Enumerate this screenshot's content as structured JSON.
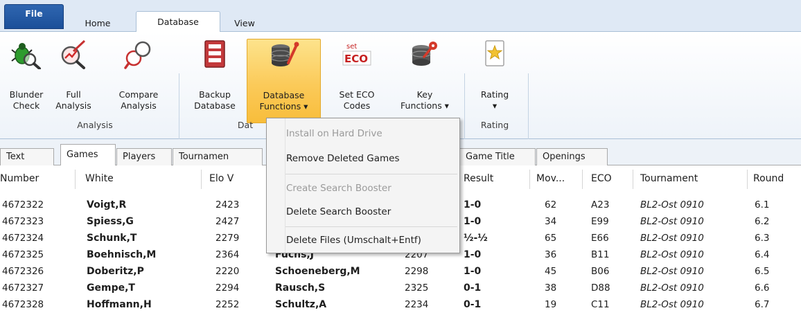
{
  "ribbon_tabs": {
    "file": "File",
    "home": "Home",
    "database": "Database",
    "view": "View"
  },
  "ribbon": {
    "analysis_group": {
      "label": "Analysis",
      "blunder_check": [
        "Blunder",
        "Check"
      ],
      "full_analysis": [
        "Full",
        "Analysis"
      ],
      "compare_analysis": [
        "Compare",
        "Analysis"
      ]
    },
    "database_group": {
      "label": "Dat",
      "backup_database": [
        "Backup",
        "Database"
      ],
      "database_functions": [
        "Database",
        "Functions ▾"
      ],
      "set_eco_codes": [
        "Set ECO",
        "Codes"
      ],
      "key_functions": [
        "Key",
        "Functions ▾"
      ]
    },
    "rating_group": {
      "label": "Rating",
      "rating": [
        "Rating",
        "▾"
      ]
    },
    "eco_icon_text": {
      "small": "set",
      "big": "ECO"
    },
    "active_color": "#fbca59"
  },
  "view_tabs": [
    "Text",
    "Games",
    "Players",
    "Tournamen",
    "Game Title",
    "Openings"
  ],
  "menu": {
    "install": "Install on Hard Drive",
    "remove_deleted": "Remove Deleted Games",
    "create_booster": "Create Search Booster",
    "delete_booster": "Delete Search Booster",
    "delete_files": "Delete Files (Umschalt+Entf)"
  },
  "table": {
    "headers": {
      "number": "Number",
      "white": "White",
      "elo_white": "Elo V",
      "result": "Result",
      "moves": "Mov...",
      "eco": "ECO",
      "tournament": "Tournament",
      "round": "Round"
    },
    "rows": [
      {
        "number": "4672322",
        "white": "Voigt,R",
        "elo_white": "2423",
        "black": "",
        "elo_black": "",
        "result": "1-0",
        "moves": "62",
        "eco": "A23",
        "tournament": "BL2-Ost 0910",
        "round": "6.1"
      },
      {
        "number": "4672323",
        "white": "Spiess,G",
        "elo_white": "2427",
        "black": "",
        "elo_black": "",
        "result": "1-0",
        "moves": "34",
        "eco": "E99",
        "tournament": "BL2-Ost 0910",
        "round": "6.2"
      },
      {
        "number": "4672324",
        "white": "Schunk,T",
        "elo_white": "2279",
        "black": "",
        "elo_black": "",
        "result": "½-½",
        "moves": "65",
        "eco": "E66",
        "tournament": "BL2-Ost 0910",
        "round": "6.3"
      },
      {
        "number": "4672325",
        "white": "Boehnisch,M",
        "elo_white": "2364",
        "black": "Fuchs,J",
        "elo_black": "2207",
        "result": "1-0",
        "moves": "36",
        "eco": "B11",
        "tournament": "BL2-Ost 0910",
        "round": "6.4"
      },
      {
        "number": "4672326",
        "white": "Doberitz,P",
        "elo_white": "2220",
        "black": "Schoeneberg,M",
        "elo_black": "2298",
        "result": "1-0",
        "moves": "45",
        "eco": "B06",
        "tournament": "BL2-Ost 0910",
        "round": "6.5"
      },
      {
        "number": "4672327",
        "white": "Gempe,T",
        "elo_white": "2294",
        "black": "Rausch,S",
        "elo_black": "2325",
        "result": "0-1",
        "moves": "38",
        "eco": "D88",
        "tournament": "BL2-Ost 0910",
        "round": "6.6"
      },
      {
        "number": "4672328",
        "white": "Hoffmann,H",
        "elo_white": "2252",
        "black": "Schultz,A",
        "elo_black": "2234",
        "result": "0-1",
        "moves": "19",
        "eco": "C11",
        "tournament": "BL2-Ost 0910",
        "round": "6.7"
      }
    ]
  }
}
